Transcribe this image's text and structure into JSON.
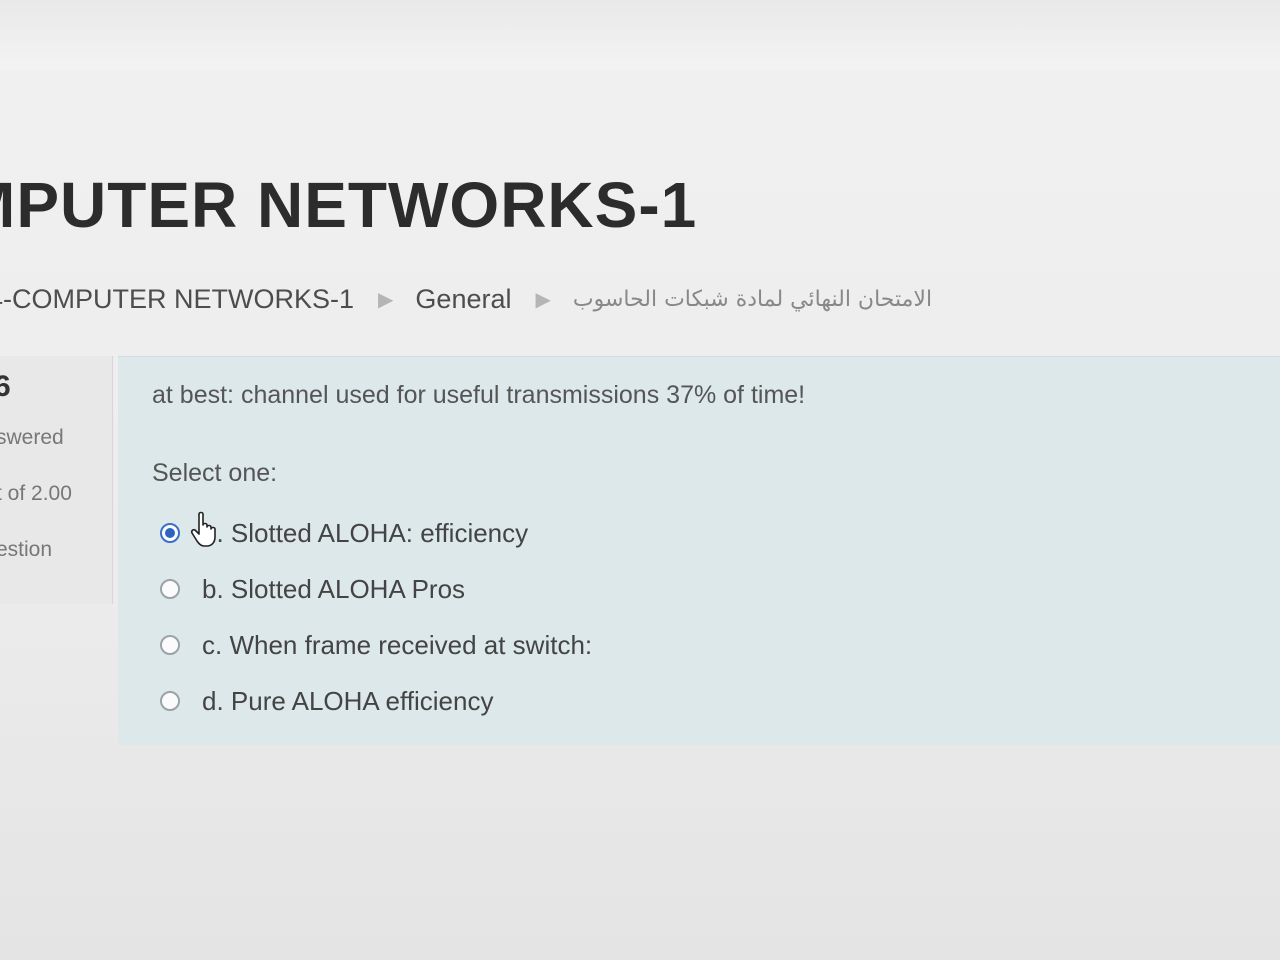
{
  "course": {
    "title": "MPUTER NETWORKS-1"
  },
  "breadcrumb": {
    "items": [
      "4-COMPUTER NETWORKS-1",
      "General",
      "الامتحان النهائي لمادة شبكات الحاسوب"
    ],
    "separator": "▶"
  },
  "question_info": {
    "number": "6",
    "state": "swered",
    "grade": "t of 2.00",
    "flag": "estion"
  },
  "question": {
    "text": "at best: channel used for useful transmissions 37% of time!",
    "prompt": "Select one:",
    "options": [
      {
        "label": "a. Slotted ALOHA: efficiency",
        "display": "n. Slotted ALOHA: efficiency",
        "selected": true
      },
      {
        "label": "b. Slotted ALOHA Pros",
        "display": "b. Slotted ALOHA Pros",
        "selected": false
      },
      {
        "label": "c. When frame received at switch:",
        "display": "c. When frame received at switch:",
        "selected": false
      },
      {
        "label": "d. Pure ALOHA efficiency",
        "display": "d. Pure ALOHA efficiency",
        "selected": false
      }
    ]
  },
  "icons": {
    "cursor": "hand-pointer-icon",
    "radio_checked": "radio-checked-icon",
    "radio_unchecked": "radio-unchecked-icon"
  },
  "colors": {
    "question_bg": "#dde8eb",
    "info_bg": "#e8e8e8",
    "radio_selected": "#2d64c2"
  }
}
